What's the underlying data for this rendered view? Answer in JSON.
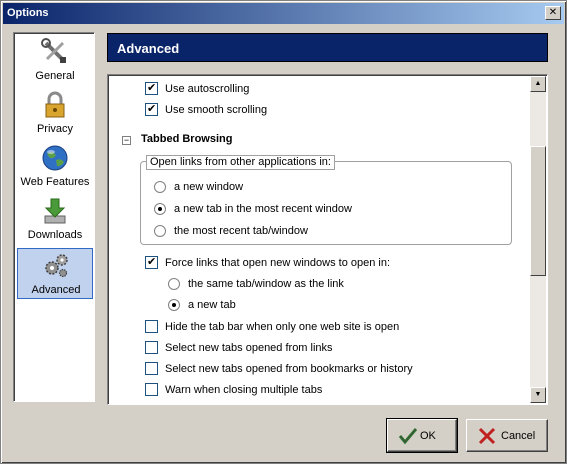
{
  "window": {
    "title": "Options",
    "close_glyph": "✕"
  },
  "categories": [
    {
      "label": "General",
      "icon": "tools-icon",
      "selected": false
    },
    {
      "label": "Privacy",
      "icon": "padlock-icon",
      "selected": false
    },
    {
      "label": "Web Features",
      "icon": "globe-icon",
      "selected": false
    },
    {
      "label": "Downloads",
      "icon": "download-icon",
      "selected": false
    },
    {
      "label": "Advanced",
      "icon": "gears-icon",
      "selected": true
    }
  ],
  "panel": {
    "title": "Advanced"
  },
  "options": {
    "use_autoscrolling": {
      "label": "Use autoscrolling",
      "checked": true
    },
    "use_smooth_scrolling": {
      "label": "Use smooth scrolling",
      "checked": true
    },
    "tabbed_browsing": {
      "title": "Tabbed Browsing",
      "toggle_glyph": "−",
      "group_label": "Open links from other applications in:",
      "open_links": [
        {
          "label": "a new window",
          "selected": false
        },
        {
          "label": "a new tab in the most recent window",
          "selected": true
        },
        {
          "label": "the most recent tab/window",
          "selected": false
        }
      ],
      "force_links": {
        "label": "Force links that open new windows to open in:",
        "checked": true
      },
      "force_choices": [
        {
          "label": "the same tab/window as the link",
          "selected": false
        },
        {
          "label": "a new tab",
          "selected": true
        }
      ],
      "hide_tab_bar": {
        "label": "Hide the tab bar when only one web site is open",
        "checked": false
      },
      "select_from_links": {
        "label": "Select new tabs opened from links",
        "checked": false
      },
      "select_from_bookmarks": {
        "label": "Select new tabs opened from bookmarks or history",
        "checked": false
      },
      "warn_closing": {
        "label": "Warn when closing multiple tabs",
        "checked": false
      }
    }
  },
  "scrollbar": {
    "up_glyph": "▲",
    "down_glyph": "▼"
  },
  "buttons": {
    "ok": "OK",
    "cancel": "Cancel"
  },
  "colors": {
    "header": "#0a246a",
    "selected_category": "#c1d2ee"
  }
}
